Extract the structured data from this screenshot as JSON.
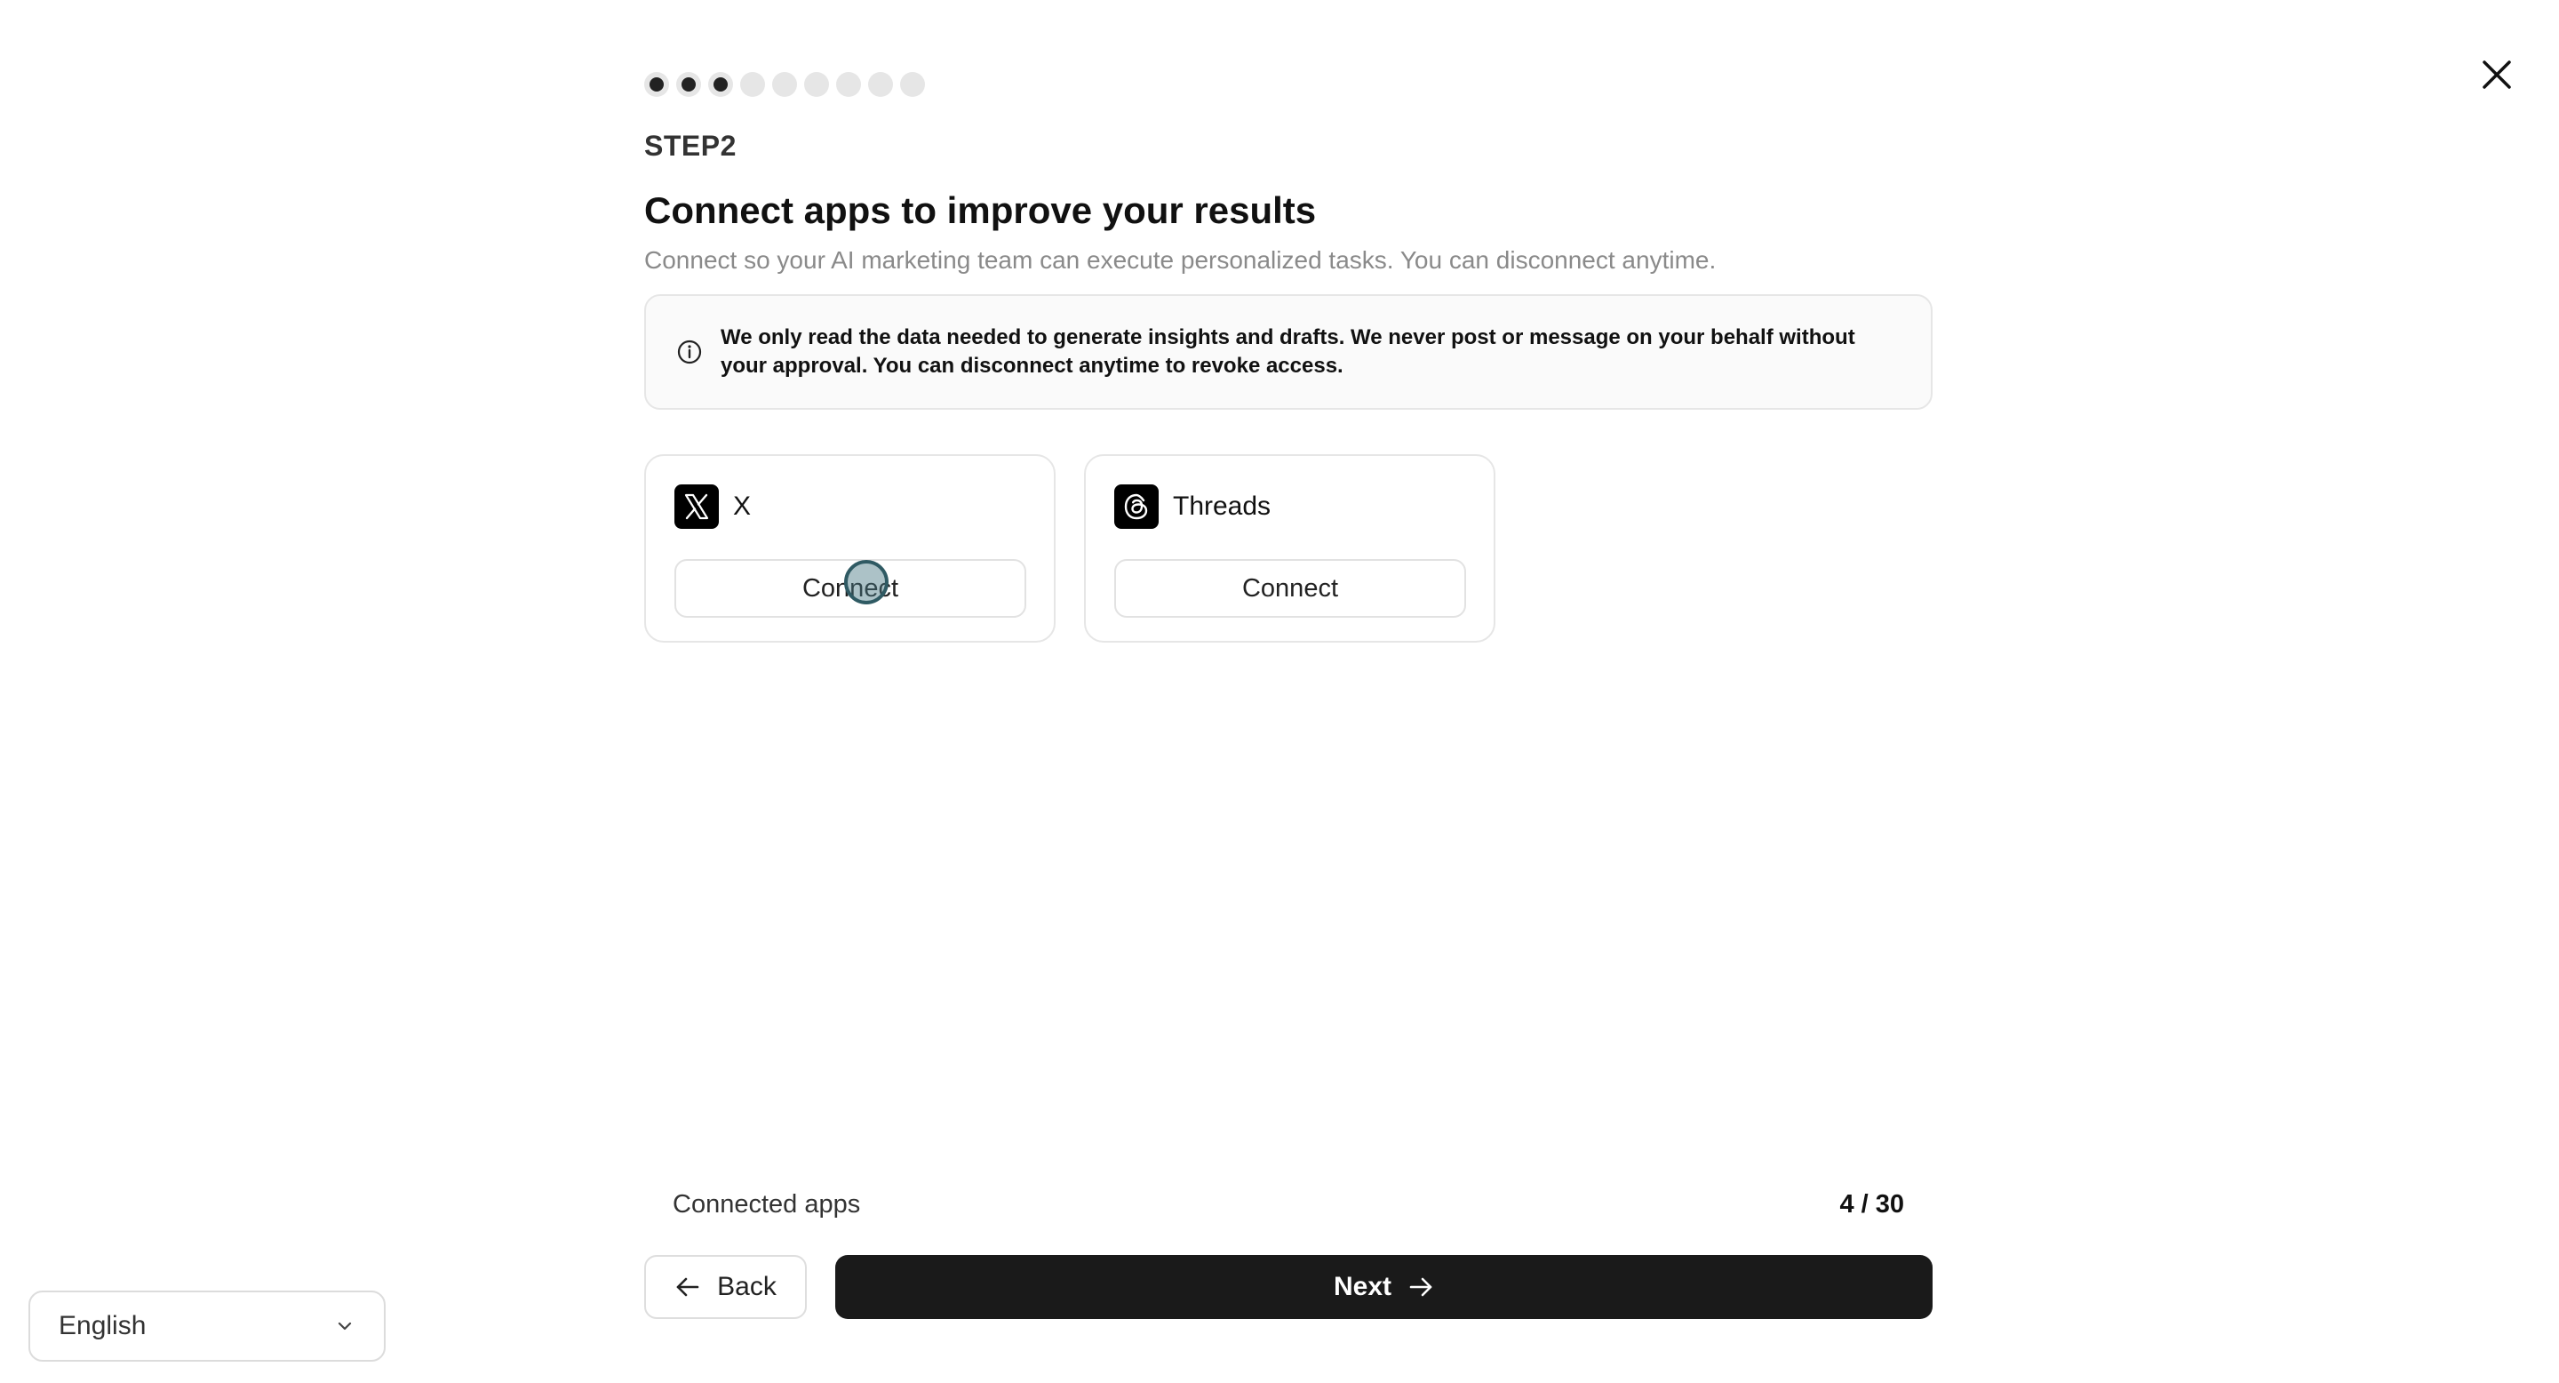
{
  "step_label": "STEP2",
  "progress": {
    "total_steps": 9,
    "completed": 3
  },
  "title": "Connect apps to improve your results",
  "subtitle": "Connect so your AI marketing team can execute personalized tasks. You can disconnect anytime.",
  "notice": {
    "icon": "info-icon",
    "text": "We only read the data needed to generate insights and drafts. We never post or message on your behalf without your approval. You can disconnect anytime to revoke access."
  },
  "apps": [
    {
      "name": "X",
      "icon": "x-logo-icon",
      "button": "Connect"
    },
    {
      "name": "Threads",
      "icon": "threads-logo-icon",
      "button": "Connect"
    }
  ],
  "connected_apps": {
    "label": "Connected apps",
    "value": "4 / 30"
  },
  "nav": {
    "back": "Back",
    "next": "Next"
  },
  "language": {
    "selected": "English"
  },
  "colors": {
    "primary_button": "#1a1a1a",
    "border": "#e6e6e6",
    "muted_text": "#8a8a8a"
  }
}
